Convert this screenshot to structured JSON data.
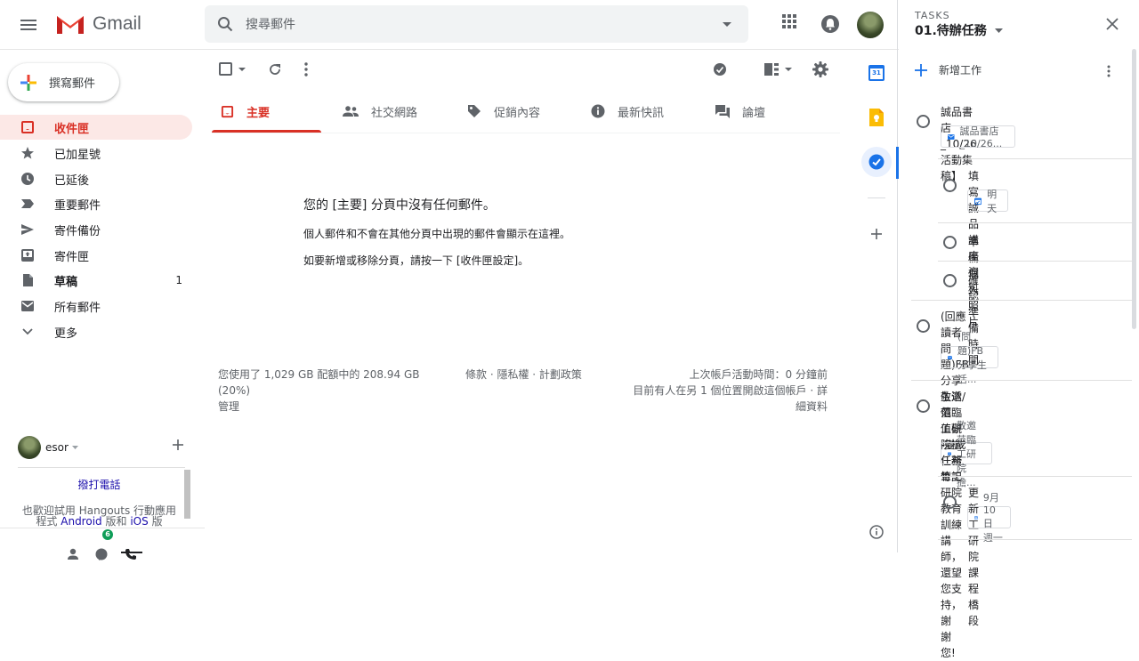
{
  "header": {
    "app_name": "Gmail",
    "search_placeholder": "搜尋郵件"
  },
  "sidebar": {
    "compose_label": "撰寫郵件",
    "items": [
      {
        "label": "收件匣",
        "count": "",
        "icon": "inbox-icon"
      },
      {
        "label": "已加星號",
        "count": "",
        "icon": "star-icon"
      },
      {
        "label": "已延後",
        "count": "",
        "icon": "clock-icon"
      },
      {
        "label": "重要郵件",
        "count": "",
        "icon": "important-icon"
      },
      {
        "label": "寄件備份",
        "count": "",
        "icon": "send-icon"
      },
      {
        "label": "寄件匣",
        "count": "",
        "icon": "outbox-icon"
      },
      {
        "label": "草稿",
        "count": "1",
        "icon": "draft-icon"
      },
      {
        "label": "所有郵件",
        "count": "",
        "icon": "mail-icon"
      },
      {
        "label": "更多",
        "count": "",
        "icon": "chevron-down-icon"
      }
    ],
    "hangouts": {
      "user_name": "esor",
      "call_link": "撥打電話",
      "promo_before": "也歡迎試用 Hangouts 行動應用程式",
      "promo_android": "Android",
      "promo_mid": "版和",
      "promo_ios": "iOS",
      "promo_after": "版",
      "badge_count": "6"
    }
  },
  "tabs": [
    {
      "label": "主要",
      "icon": "inbox-icon",
      "active": true
    },
    {
      "label": "社交網路",
      "icon": "people-icon",
      "active": false
    },
    {
      "label": "促銷內容",
      "icon": "tag-icon",
      "active": false
    },
    {
      "label": "最新快訊",
      "icon": "info-icon",
      "active": false
    },
    {
      "label": "論壇",
      "icon": "forum-icon",
      "active": false
    }
  ],
  "empty_state": {
    "title": "您的 [主要] 分頁中沒有任何郵件。",
    "line1": "個人郵件和不會在其他分頁中出現的郵件會顯示在這裡。",
    "line2": "如要新增或移除分頁，請按一下 [收件匣設定]。"
  },
  "footer": {
    "storage_line1": "您使用了 1,029 GB 配額中的 208.94 GB",
    "storage_line2": "(20%)",
    "manage": "管理",
    "links": "條款 · 隱私權 · 計劃政策",
    "activity_line1": "上次帳戶活動時間：0 分鐘前",
    "activity_line2": "目前有人在另 1 個位置開啟這個帳戶 · 詳",
    "activity_line3": "細資料"
  },
  "rail": {
    "calendar_day": "31"
  },
  "tasks": {
    "label": "TASKS",
    "list_name": "01.待辦任務",
    "new_task": "新增工作",
    "items": [
      {
        "title": "誠品書店_10/26活動集稿】",
        "chip": "誠品書店_10/26...",
        "chip_icon": "mail-icon",
        "sub": false
      },
      {
        "title": "填寫誠品講座資料",
        "chip": "明天",
        "chip_icon": "calendar-icon",
        "sub": true
      },
      {
        "title": "準備個人照片",
        "chip": "",
        "sub": true
      },
      {
        "title": "確認準備時間",
        "chip": "",
        "sub": true
      },
      {
        "title_lines": [
          "(回應讀者問題)FB分享生活/價",
          "值觀 -變成任務筆記"
        ],
        "chip": "(問題)FB分享生活...",
        "chip_icon": "mail-icon",
        "sub": false
      },
      {
        "title_lines": [
          "敬邀范臨工研院擔任新竹工研院",
          "教育訓練講師，還望您支持，謝",
          "謝您!"
        ],
        "chip": "敬邀范臨工研院擔...",
        "chip_icon": "mail-icon",
        "sub": false
      },
      {
        "title": "更新工研院課程橋段",
        "chip": "9月10日 週一",
        "chip_icon": "calendar-icon",
        "sub": true
      }
    ]
  },
  "colors": {
    "accent_red": "#d93025",
    "active_bg": "#fce8e6",
    "blue": "#1a73e8"
  }
}
